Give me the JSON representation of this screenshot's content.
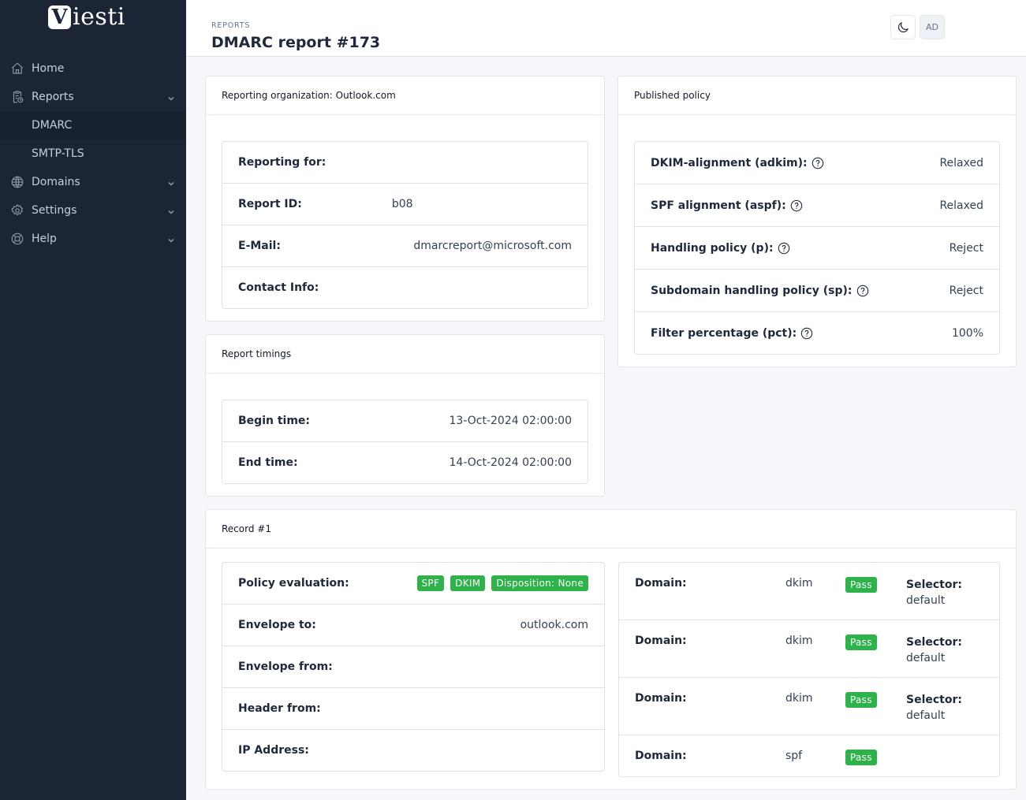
{
  "app": {
    "logo_letter": "V",
    "logo_text": "iesti"
  },
  "sidebar": {
    "items": [
      {
        "label": "Home",
        "icon": "home-icon"
      },
      {
        "label": "Reports",
        "icon": "clipboard-clock-icon",
        "expandable": true,
        "expanded": true,
        "children": [
          {
            "label": "DMARC",
            "active": true
          },
          {
            "label": "SMTP-TLS"
          }
        ]
      },
      {
        "label": "Domains",
        "icon": "globe-icon",
        "expandable": true
      },
      {
        "label": "Settings",
        "icon": "gear-icon",
        "expandable": true
      },
      {
        "label": "Help",
        "icon": "lifebuoy-icon",
        "expandable": true
      }
    ]
  },
  "header": {
    "breadcrumb": "REPORTS",
    "title": "DMARC report #173",
    "theme_toggle_icon": "moon-icon",
    "avatar_initials": "AD"
  },
  "org_card": {
    "title": "Reporting organization: Outlook.com",
    "rows": [
      {
        "label": "Reporting for:",
        "value": ""
      },
      {
        "label": "Report ID:",
        "value": "b08"
      },
      {
        "label": "E-Mail:",
        "value": "dmarcreport@microsoft.com"
      },
      {
        "label": "Contact Info:",
        "value": ""
      }
    ]
  },
  "timings_card": {
    "title": "Report timings",
    "rows": [
      {
        "label": "Begin time:",
        "value": "13-Oct-2024 02:00:00"
      },
      {
        "label": "End time:",
        "value": "14-Oct-2024 02:00:00"
      }
    ]
  },
  "policy_card": {
    "title": "Published policy",
    "rows": [
      {
        "label": "DKIM-alignment (adkim):",
        "value": "Relaxed"
      },
      {
        "label": "SPF alignment (aspf):",
        "value": "Relaxed"
      },
      {
        "label": "Handling policy (p):",
        "value": "Reject"
      },
      {
        "label": "Subdomain handling policy (sp):",
        "value": "Reject"
      },
      {
        "label": "Filter percentage (pct):",
        "value": "100%"
      }
    ]
  },
  "record_card": {
    "title": "Record #1",
    "details": [
      {
        "label": "Policy evaluation:",
        "badges": [
          "SPF",
          "DKIM",
          "Disposition: None"
        ]
      },
      {
        "label": "Envelope to:",
        "value": "outlook.com"
      },
      {
        "label": "Envelope from:",
        "value": ""
      },
      {
        "label": "Header from:",
        "value": ""
      },
      {
        "label": "IP Address:",
        "value": ""
      }
    ],
    "auth_results": [
      {
        "domain_label": "Domain:",
        "domain": "",
        "type": "dkim",
        "result": "Pass",
        "selector_label": "Selector:",
        "selector": "default"
      },
      {
        "domain_label": "Domain:",
        "domain": "",
        "type": "dkim",
        "result": "Pass",
        "selector_label": "Selector:",
        "selector": "default"
      },
      {
        "domain_label": "Domain:",
        "domain": "",
        "type": "dkim",
        "result": "Pass",
        "selector_label": "Selector:",
        "selector": "default"
      },
      {
        "domain_label": "Domain:",
        "domain": "",
        "type": "spf",
        "result": "Pass"
      }
    ]
  },
  "colors": {
    "sidebar_bg": "#1b2535",
    "pass_badge": "#2db34a",
    "page_bg": "#f5f7fb"
  }
}
